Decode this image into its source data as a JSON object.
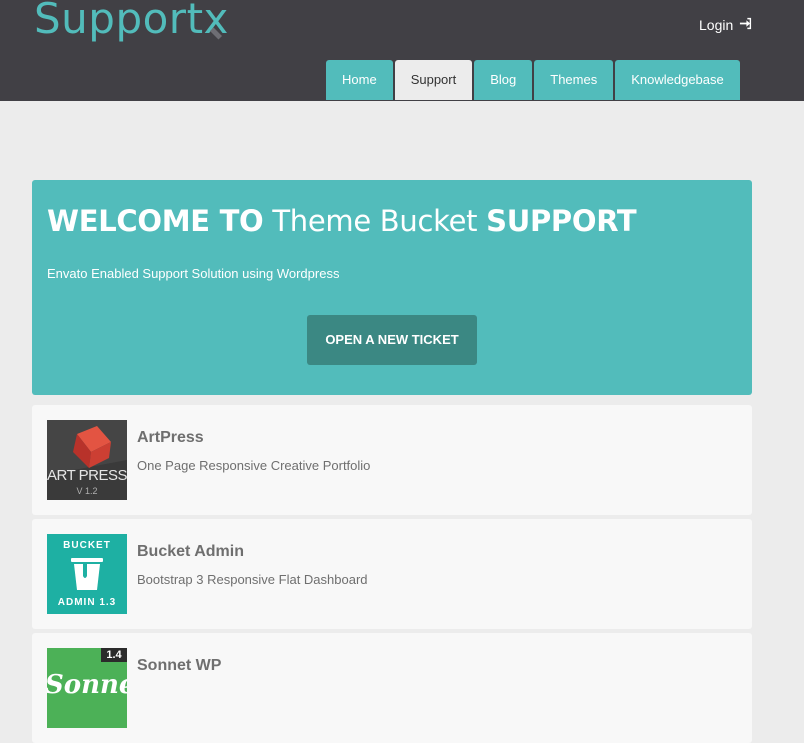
{
  "header": {
    "logo_main": "Support",
    "logo_x": "x",
    "login_label": "Login",
    "login_icon": "sign-in-icon",
    "accent_color": "#52bcbb",
    "bg_color": "#414045"
  },
  "nav": {
    "tabs": [
      {
        "label": "Home",
        "active": false
      },
      {
        "label": "Support",
        "active": true
      },
      {
        "label": "Blog",
        "active": false
      },
      {
        "label": "Themes",
        "active": false
      },
      {
        "label": "Knowledgebase",
        "active": false
      }
    ]
  },
  "hero": {
    "title_bold_1": "WELCOME TO",
    "title_light": "Theme Bucket",
    "title_bold_2": "SUPPORT",
    "subtitle": "Envato Enabled Support Solution using Wordpress",
    "button_label": "OPEN A NEW TICKET",
    "bg_color": "#52bcbb",
    "button_color": "#3b8883"
  },
  "products": [
    {
      "title": "ArtPress",
      "description": "One Page Responsive Creative Portfolio",
      "thumb": {
        "text": "ART PRESS",
        "version": "V 1.2"
      }
    },
    {
      "title": "Bucket Admin",
      "description": "Bootstrap 3 Responsive Flat Dashboard",
      "thumb": {
        "top": "BUCKET",
        "bottom": "ADMIN  1.3"
      }
    },
    {
      "title": "Sonnet WP",
      "description": "",
      "thumb": {
        "badge": "1.4",
        "word": "Sonnet"
      }
    }
  ]
}
